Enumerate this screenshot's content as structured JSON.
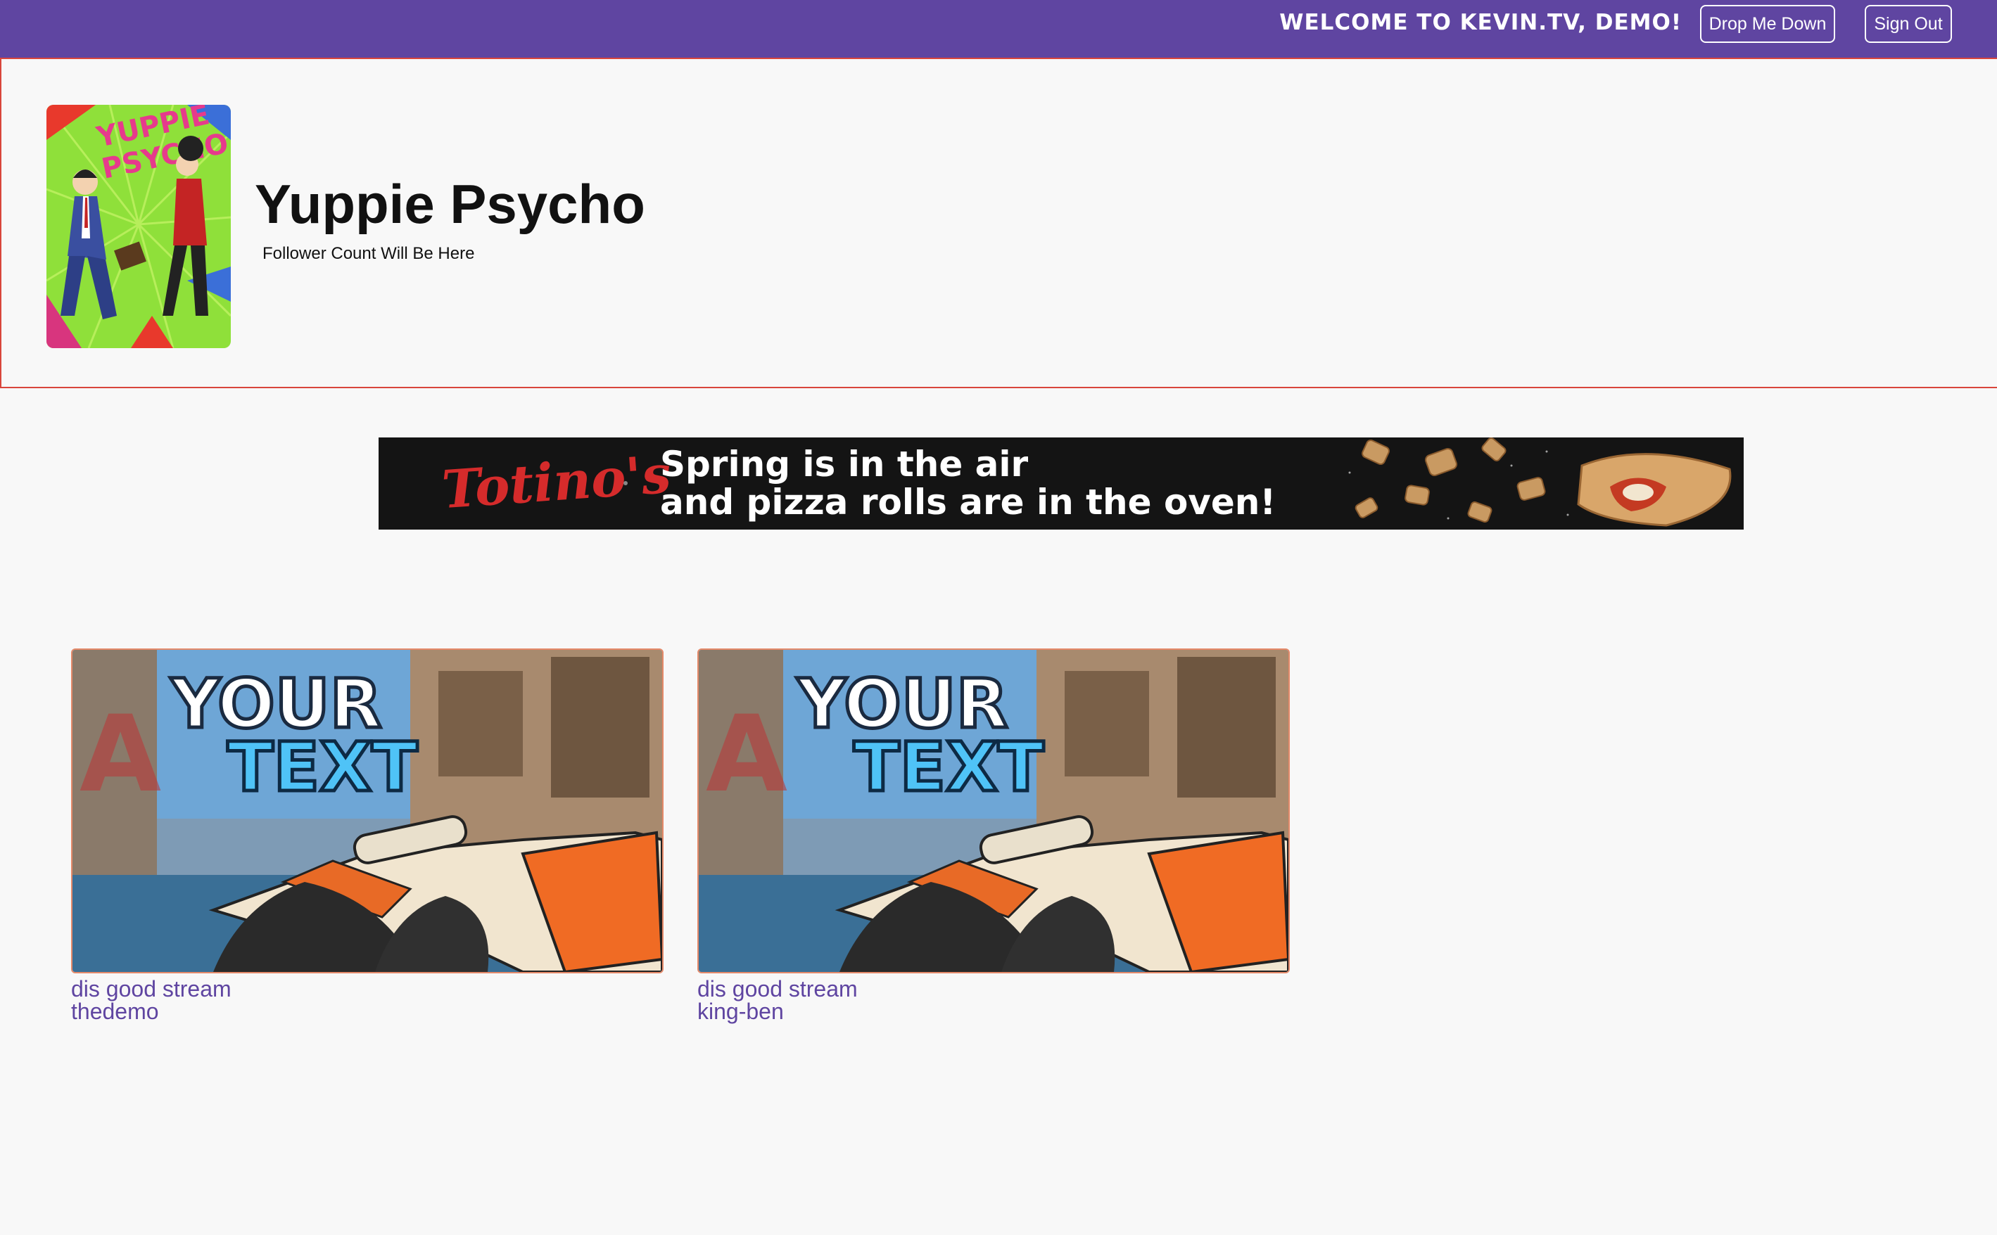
{
  "header": {
    "welcome": "WELCOME TO KEVIN.TV, DEMO!",
    "drop_label": "Drop Me Down",
    "signout_label": "Sign Out"
  },
  "game": {
    "title": "Yuppie Psycho",
    "follower_text": "Follower Count Will Be Here",
    "cover_art_text": "YUPPIE PSYCHO"
  },
  "ad": {
    "brand": "Totino's",
    "line1": "Spring is in the air",
    "line2": "and pizza rolls are in the oven!"
  },
  "streams": [
    {
      "title": "dis good stream",
      "user": "thedemo",
      "thumb_text_1": "YOUR",
      "thumb_text_2": "TEXT"
    },
    {
      "title": "dis good stream",
      "user": "king-ben",
      "thumb_text_1": "YOUR",
      "thumb_text_2": "TEXT"
    }
  ],
  "colors": {
    "brand_purple": "#5f45a1",
    "header_border": "#d9463b",
    "page_bg": "#f8f8f8"
  }
}
